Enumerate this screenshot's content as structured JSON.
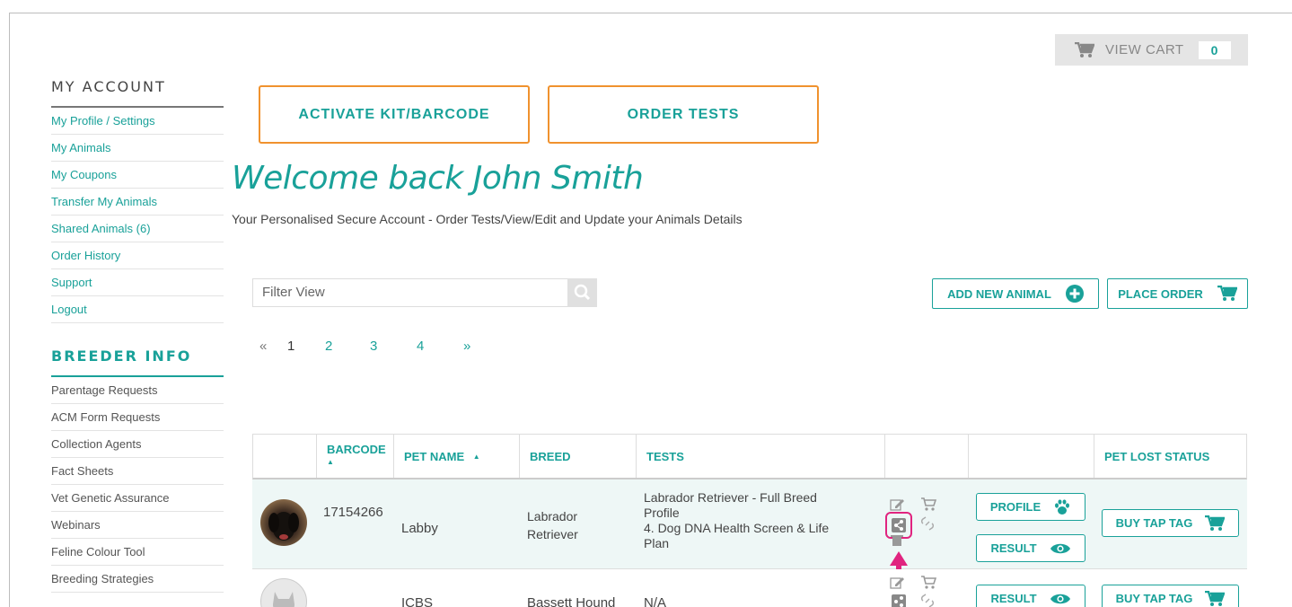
{
  "cart": {
    "label": "VIEW CART",
    "count": "0"
  },
  "sidebar": {
    "account_title": "MY ACCOUNT",
    "account_items": [
      "My Profile / Settings",
      "My Animals",
      "My Coupons",
      "Transfer My Animals",
      "Shared Animals (6)",
      "Order History",
      "Support",
      "Logout"
    ],
    "breeder_title": "BREEDER INFO",
    "breeder_items": [
      "Parentage Requests",
      "ACM Form Requests",
      "Collection Agents",
      "Fact Sheets",
      "Vet Genetic Assurance",
      "Webinars",
      "Feline Colour Tool",
      "Breeding Strategies"
    ]
  },
  "actions": {
    "activate": "ACTIVATE KIT/BARCODE",
    "order": "ORDER TESTS",
    "add_animal": "ADD NEW ANIMAL",
    "place_order": "PLACE ORDER"
  },
  "welcome": "Welcome back  John Smith",
  "subtitle": "Your Personalised Secure Account - Order Tests/View/Edit and Update your Animals Details",
  "filter": {
    "placeholder": "Filter View"
  },
  "pagination": {
    "prev": "«",
    "pages": [
      "1",
      "2",
      "3",
      "4"
    ],
    "next": "»",
    "current": "1"
  },
  "table": {
    "headers": {
      "barcode": "BARCODE",
      "pet_name": "PET NAME",
      "breed": "BREED",
      "tests": "TESTS",
      "pet_lost": "PET LOST STATUS"
    },
    "rows": [
      {
        "barcode": "17154266",
        "pet_name": "Labby",
        "breed_line1": "Labrador",
        "breed_line2": "Retriever",
        "tests": [
          "Labrador Retriever - Full Breed",
          "Profile",
          "4. Dog DNA Health Screen & Life",
          "Plan"
        ],
        "profile_label": "PROFILE",
        "result_label": "RESULT",
        "tap_label": "BUY TAP TAG"
      },
      {
        "barcode": "",
        "pet_name": "ICBS",
        "breed": "Bassett Hound",
        "tests": "N/A",
        "result_label": "RESULT",
        "tap_label": "BUY TAP TAG"
      }
    ]
  },
  "colors": {
    "teal": "#19a199",
    "orange": "#f0922e",
    "highlight": "#e0247f"
  }
}
